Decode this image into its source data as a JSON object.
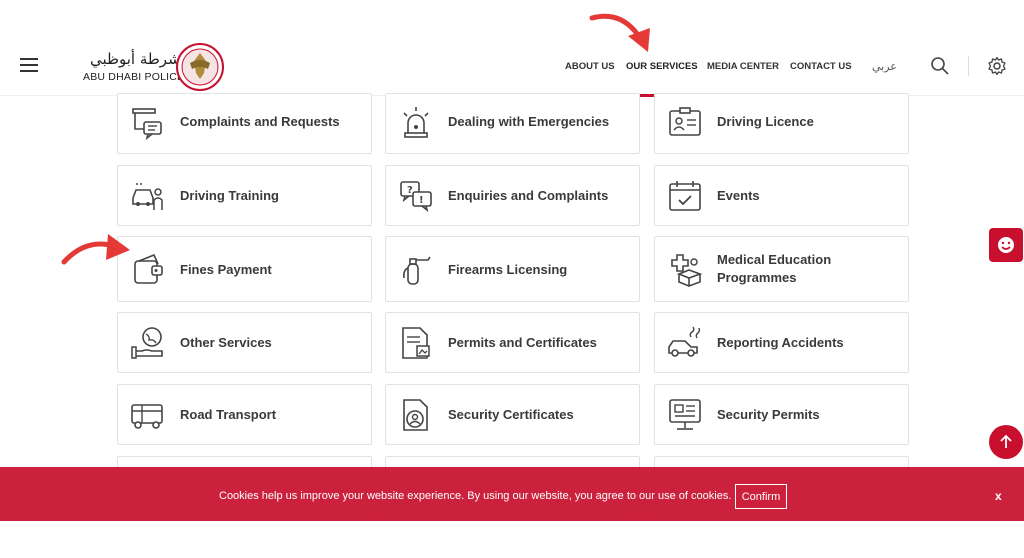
{
  "header": {
    "logo_arabic": "شرطة أبوظبي",
    "logo_english": "ABU DHABI POLICE",
    "nav": [
      "ABOUT US",
      "OUR SERVICES",
      "MEDIA CENTER",
      "CONTACT US"
    ],
    "active_nav": "OUR SERVICES",
    "language": "عربي",
    "accent_color": "#c8102e"
  },
  "services": [
    {
      "label": "Complaints and Requests",
      "icon": "complaint-icon"
    },
    {
      "label": "Dealing with Emergencies",
      "icon": "siren-icon"
    },
    {
      "label": "Driving Licence",
      "icon": "id-card-icon"
    },
    {
      "label": "Driving Training",
      "icon": "driving-training-icon"
    },
    {
      "label": "Enquiries and Complaints",
      "icon": "chat-question-icon"
    },
    {
      "label": "Events",
      "icon": "calendar-icon"
    },
    {
      "label": "Fines Payment",
      "icon": "wallet-icon"
    },
    {
      "label": "Firearms Licensing",
      "icon": "extinguisher-icon"
    },
    {
      "label": "Medical Education Programmes",
      "icon": "medical-box-icon"
    },
    {
      "label": "Other Services",
      "icon": "hand-globe-icon"
    },
    {
      "label": "Permits and Certificates",
      "icon": "certificate-icon"
    },
    {
      "label": "Reporting Accidents",
      "icon": "car-accident-icon"
    },
    {
      "label": "Road Transport",
      "icon": "truck-icon"
    },
    {
      "label": "Security Certificates",
      "icon": "security-certificate-icon"
    },
    {
      "label": "Security Permits",
      "icon": "monitor-permit-icon"
    }
  ],
  "cookie_bar": {
    "text": "Cookies help us improve your website experience. By using our website, you agree to our use of cookies.",
    "confirm_label": "Confirm",
    "close_label": "x"
  }
}
